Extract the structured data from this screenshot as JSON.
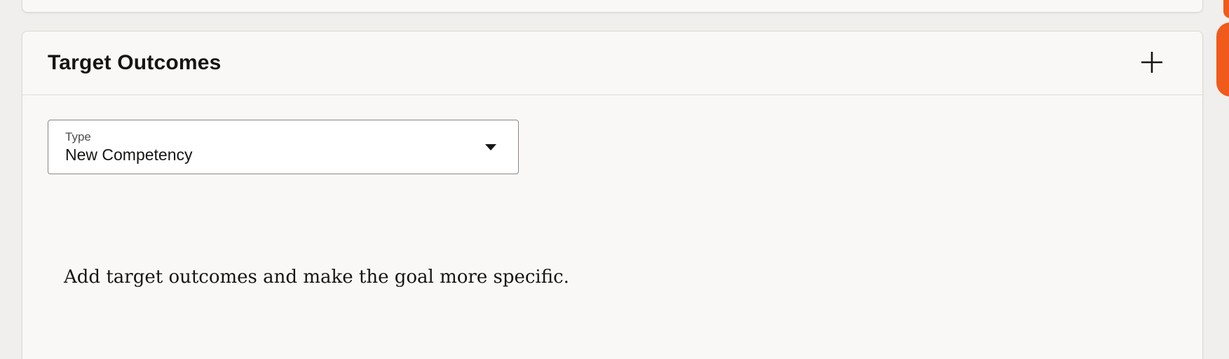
{
  "section": {
    "title": "Target Outcomes",
    "add_icon": "plus-icon"
  },
  "type_field": {
    "label": "Type",
    "value": "New Competency",
    "icon": "caret-down-icon"
  },
  "empty_state": {
    "message": "Add target outcomes and make the goal more specific."
  },
  "colors": {
    "background": "#f1efed",
    "card": "#f9f8f6",
    "text": "#161513",
    "accent_widget": "#f05a1a"
  }
}
